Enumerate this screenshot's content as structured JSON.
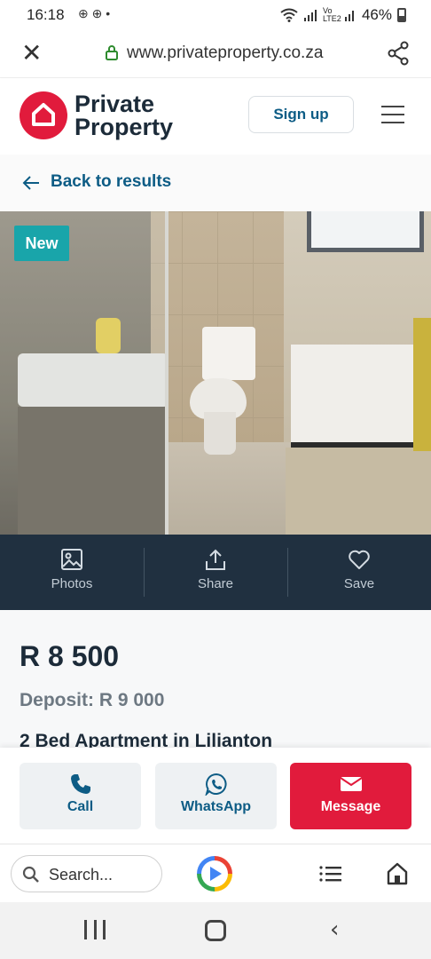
{
  "status_bar": {
    "time": "16:18",
    "notifications": "⊕ ⊕ •",
    "network": "Vo LTE2",
    "battery": "46%"
  },
  "browser": {
    "url": "www.privateproperty.co.za"
  },
  "site": {
    "brand_line1": "Private",
    "brand_line2": "Property",
    "signup_label": "Sign up",
    "brand_color": "#e11b3c",
    "link_color": "#0d5c85"
  },
  "nav": {
    "back_label": "Back to results"
  },
  "listing": {
    "badge": "New",
    "price": "R 8 500",
    "deposit": "Deposit: R 9 000",
    "title": "2 Bed Apartment in Lilianton"
  },
  "photo_actions": [
    {
      "label": "Photos",
      "icon": "image-icon"
    },
    {
      "label": "Share",
      "icon": "share-icon"
    },
    {
      "label": "Save",
      "icon": "heart-icon"
    }
  ],
  "contact": {
    "call_label": "Call",
    "whatsapp_label": "WhatsApp",
    "message_label": "Message"
  },
  "browser_toolbar": {
    "search_placeholder": "Search..."
  }
}
